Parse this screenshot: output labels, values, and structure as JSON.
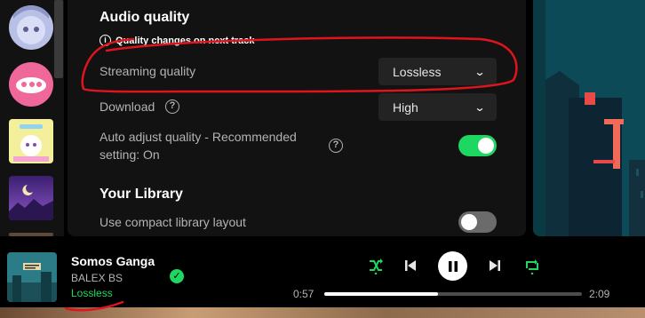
{
  "settings": {
    "audio_quality": {
      "title": "Audio quality",
      "note": "Quality changes on next track",
      "streaming_quality": {
        "label": "Streaming quality",
        "value": "Lossless"
      },
      "download": {
        "label": "Download",
        "value": "High"
      },
      "auto_adjust": {
        "label_line1": "Auto adjust quality - Recommended",
        "label_line2": "setting: On",
        "enabled": true
      }
    },
    "your_library": {
      "title": "Your Library",
      "compact_layout": {
        "label": "Use compact library layout",
        "enabled": false
      }
    }
  },
  "player": {
    "track": {
      "title": "Somos Ganga",
      "artist": "BALEX BS",
      "quality": "Lossless"
    },
    "elapsed": "0:57",
    "duration": "2:09",
    "progress_fraction": 0.44
  },
  "colors": {
    "accent": "#1ed760",
    "annotation": "#e0141e"
  },
  "icons": [
    "info-icon",
    "help-icon",
    "chevron-down-icon",
    "check-icon",
    "smart-shuffle-icon",
    "previous-icon",
    "pause-icon",
    "next-icon",
    "repeat-icon"
  ]
}
